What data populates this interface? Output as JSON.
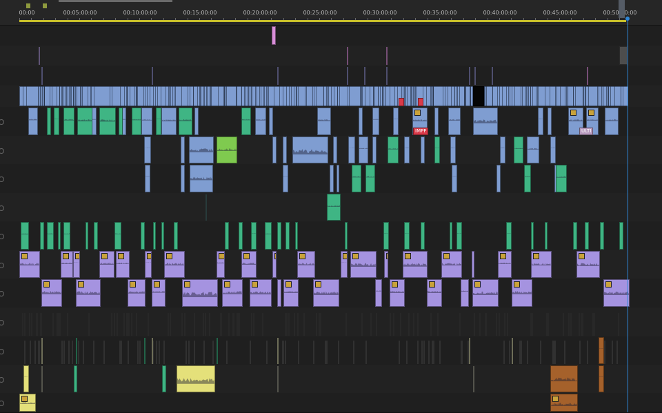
{
  "ruler": {
    "ticks": [
      "00:00",
      "00:05:00:00",
      "00:10:00:00",
      "00:15:00:00",
      "00:20:00:00",
      "00:25:00:00",
      "00:30:00:00",
      "00:35:00:00",
      "00:40:00:00",
      "00:45:00:00",
      "00:50:00:00"
    ]
  },
  "colors": {
    "video_blue": "#7f9dd1",
    "green": "#3fb584",
    "purple": "#a593e0",
    "lime": "#7fca4f",
    "yellow": "#e4e07a",
    "brown": "#a5612b",
    "pink": "#d88ed8",
    "red": "#d93a49",
    "playhead": "#2f86d6",
    "work_area": "#c7bf2a"
  },
  "tracks": [
    {
      "name": "track-v6",
      "kind": "video"
    },
    {
      "name": "track-v5",
      "kind": "video"
    },
    {
      "name": "track-v4",
      "kind": "video"
    },
    {
      "name": "track-v3",
      "kind": "video"
    },
    {
      "name": "track-v2",
      "kind": "video"
    },
    {
      "name": "track-v1",
      "kind": "video"
    },
    {
      "name": "track-a1",
      "kind": "audio"
    },
    {
      "name": "track-a2",
      "kind": "audio"
    },
    {
      "name": "track-a3",
      "kind": "audio"
    },
    {
      "name": "track-a4",
      "kind": "audio"
    },
    {
      "name": "track-a5",
      "kind": "audio"
    },
    {
      "name": "track-a6",
      "kind": "audio"
    },
    {
      "name": "track-a7",
      "kind": "audio"
    },
    {
      "name": "track-a8",
      "kind": "audio"
    },
    {
      "name": "track-a9",
      "kind": "audio"
    },
    {
      "name": "track-a10",
      "kind": "audio"
    }
  ],
  "clip_labels": [
    "IMPF",
    "ULTI"
  ]
}
